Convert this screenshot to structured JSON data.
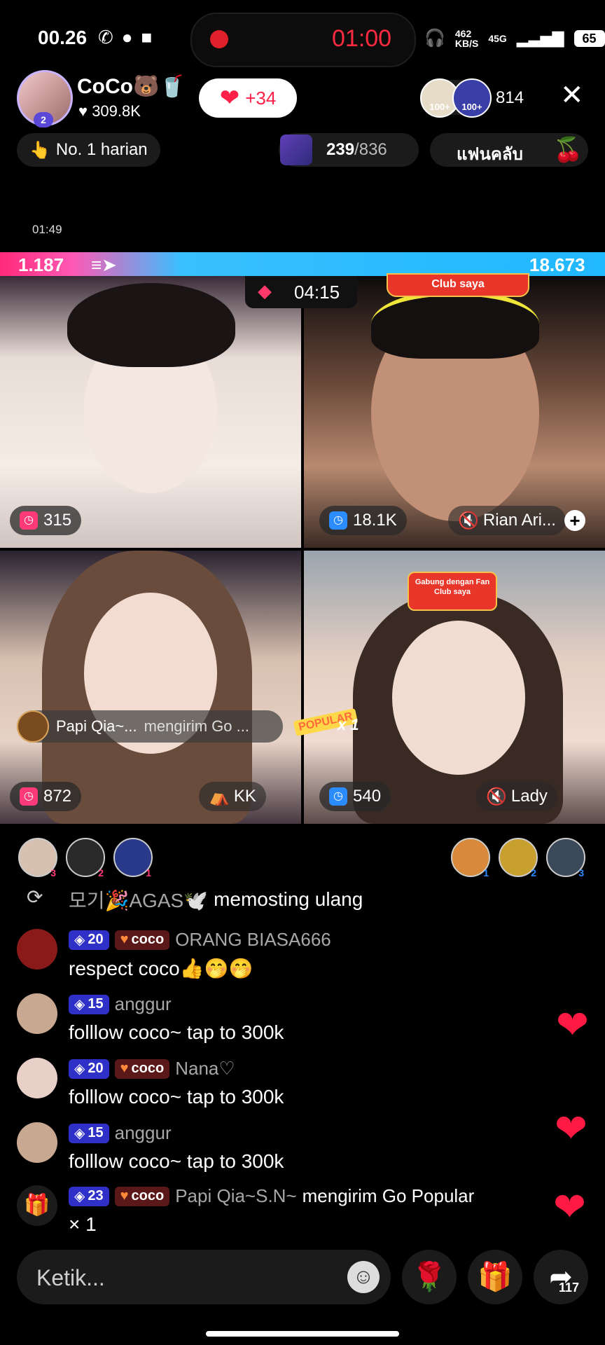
{
  "status": {
    "time": "00.26",
    "notif_icons": [
      "whatsapp-icon",
      "chat-icon",
      "video-icon"
    ],
    "record_timer": "01:00",
    "net_speed_top": "462",
    "net_speed_unit": "KB/S",
    "signal": "45G",
    "battery": "65"
  },
  "host": {
    "name": "CoCo🐻🥤",
    "level": "2",
    "likes": "309.8K",
    "like_button_count": "+34",
    "viewers": [
      {
        "badge": "100+"
      },
      {
        "badge": "100+"
      }
    ],
    "viewer_count": "814",
    "rank_label": "No. 1 harian",
    "gift_progress": "239",
    "gift_goal": "/836",
    "fan_club_label": "แฟนคลับ"
  },
  "elapsed": "01:49",
  "battle": {
    "left_score": "1.187",
    "right_score": "18.673",
    "timer": "04:15",
    "club_banner": "Club saya"
  },
  "tiles": [
    {
      "score": "315",
      "name": ""
    },
    {
      "score": "18.1K",
      "name": "Rian Ari..."
    },
    {
      "score": "872",
      "name": "KK"
    },
    {
      "score": "540",
      "name": "Lady"
    }
  ],
  "gift_notice": {
    "user": "Papi Qia~...",
    "message": "mengirim Go ...",
    "popular_tag": "POPULAR",
    "multiplier": "x 1"
  },
  "fan_mini_text": "Gabung dengan Fan Club saya",
  "supporters_left": [
    "3",
    "2",
    "1"
  ],
  "supporters_right": [
    "1",
    "2",
    "3"
  ],
  "chat": [
    {
      "type": "repost",
      "user": "모기🎉AGAS🕊️",
      "text": "memosting ulang"
    },
    {
      "level": "20",
      "fan": "coco",
      "user": "ORANG BIASA666",
      "text": "respect coco👍🤭🤭"
    },
    {
      "level": "15",
      "fan": "",
      "user": "anggur",
      "text": "folllow coco~ tap to 300k"
    },
    {
      "level": "20",
      "fan": "coco",
      "user": "Nana♡",
      "text": "folllow coco~ tap to 300k"
    },
    {
      "level": "15",
      "fan": "",
      "user": "anggur",
      "text": "folllow coco~ tap to 300k"
    },
    {
      "level": "23",
      "fan": "coco",
      "user": "Papi Qia~S.N~",
      "text": "mengirim Go Popular",
      "text2": "× 1"
    }
  ],
  "bottom": {
    "input_placeholder": "Ketik...",
    "share_count": "117"
  },
  "colors": {
    "accent_pink": "#ff2a7a",
    "accent_blue": "#20b8ff",
    "record_red": "#ff2a40",
    "level_badge": "#2f30c8"
  }
}
